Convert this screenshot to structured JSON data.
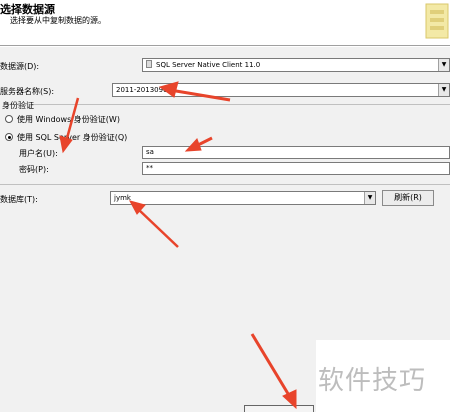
{
  "header": {
    "title": "选择数据源",
    "subtitle": "选择要从中复制数据的源。"
  },
  "form": {
    "data_source_label": "数据源(D):",
    "data_source_value": "SQL Server Native Client 11.0",
    "server_label": "服务器名称(S):",
    "server_value": "2011-20130907IL",
    "auth_group_label": "身份验证",
    "windows_auth_label": "使用 Windows 身份验证(W)",
    "sql_auth_label": "使用 SQL Server 身份验证(Q)",
    "username_label": "用户名(U):",
    "username_value": "sa",
    "password_label": "密码(P):",
    "password_value": "**",
    "database_label": "数据库(T):",
    "database_value": "jymk",
    "refresh_label": "刷新(R)"
  },
  "watermark": "软件技巧",
  "colors": {
    "annotation_arrow": "#e8442b",
    "header_bg": "#ffffff",
    "panel_bg": "#f1f1f1"
  }
}
